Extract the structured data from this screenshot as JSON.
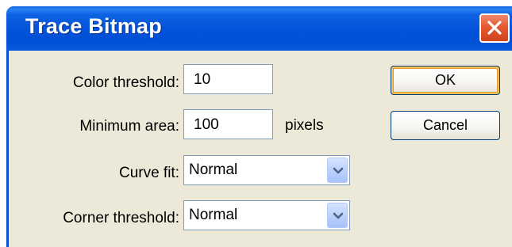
{
  "window": {
    "title": "Trace Bitmap"
  },
  "form": {
    "color_threshold": {
      "label": "Color threshold:",
      "value": "10"
    },
    "minimum_area": {
      "label": "Minimum area:",
      "value": "100",
      "unit": "pixels"
    },
    "curve_fit": {
      "label": "Curve fit:",
      "selected": "Normal"
    },
    "corner_threshold": {
      "label": "Corner threshold:",
      "selected": "Normal"
    }
  },
  "buttons": {
    "ok": "OK",
    "cancel": "Cancel"
  },
  "icons": {
    "close": "close-icon",
    "dropdown": "chevron-down-icon"
  },
  "colors": {
    "titlebar": "#0453d9",
    "dialog_bg": "#ece9d8",
    "close": "#e45a33"
  }
}
